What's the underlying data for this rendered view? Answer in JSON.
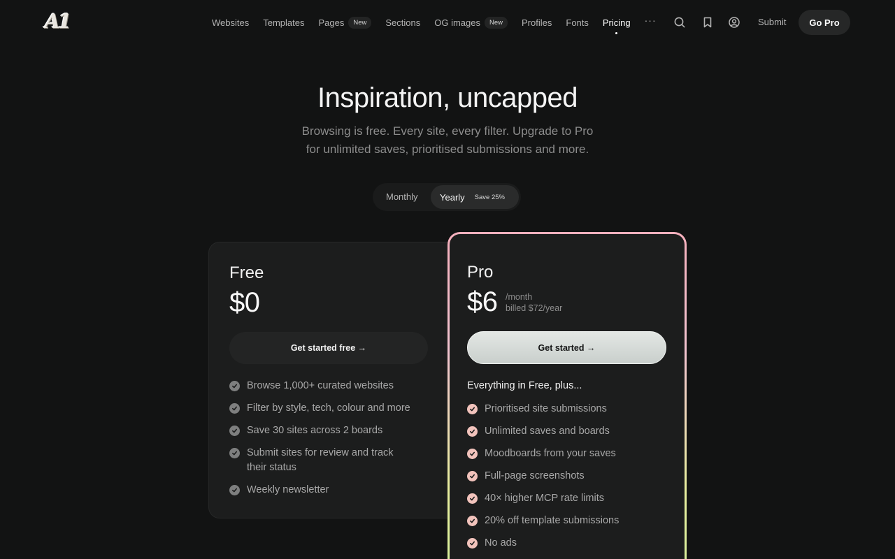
{
  "nav": {
    "logo": "A1",
    "links": [
      {
        "label": "Websites"
      },
      {
        "label": "Templates"
      },
      {
        "label": "Pages",
        "badge": "New"
      },
      {
        "label": "Sections"
      },
      {
        "label": "OG images",
        "badge": "New"
      },
      {
        "label": "Profiles"
      },
      {
        "label": "Fonts"
      },
      {
        "label": "Pricing",
        "active": true
      }
    ],
    "more": "···",
    "icons": [
      "search-icon",
      "bookmark-icon",
      "user-circle-icon"
    ],
    "submit": "Submit",
    "go_pro": "Go Pro"
  },
  "hero": {
    "title": "Inspiration, uncapped",
    "subtitle_line1": "Browsing is free. Every site, every filter. Upgrade to Pro",
    "subtitle_line2": "for unlimited saves, prioritised submissions and more."
  },
  "billing_toggle": {
    "monthly": "Monthly",
    "yearly": "Yearly",
    "yearly_badge": "Save 25%",
    "selected": "Yearly"
  },
  "plans": {
    "free": {
      "name": "Free",
      "price": "$0",
      "cta": "Get started free →",
      "features": [
        "Browse 1,000+ curated websites",
        "Filter by style, tech, colour and more",
        "Save 30 sites across 2 boards",
        "Submit sites for review and track their status",
        "Weekly newsletter"
      ]
    },
    "pro": {
      "name": "Pro",
      "price": "$6",
      "period": "/month",
      "billing_note": "billed $72/year",
      "cta": "Get started →",
      "features_heading": "Everything in Free, plus...",
      "features": [
        "Prioritised site submissions",
        "Unlimited saves and boards",
        "Moodboards from your saves",
        "Full-page screenshots",
        "40× higher MCP rate limits",
        "20% off template submissions",
        "No ads"
      ]
    }
  },
  "colors": {
    "background": "#121313",
    "card": "#1c1d1d",
    "pro_border_top": "#f6b0bd",
    "pro_border_bottom": "#d7f09a",
    "check_free": "#7e7f7f",
    "check_pro": "#f2c3bc"
  }
}
